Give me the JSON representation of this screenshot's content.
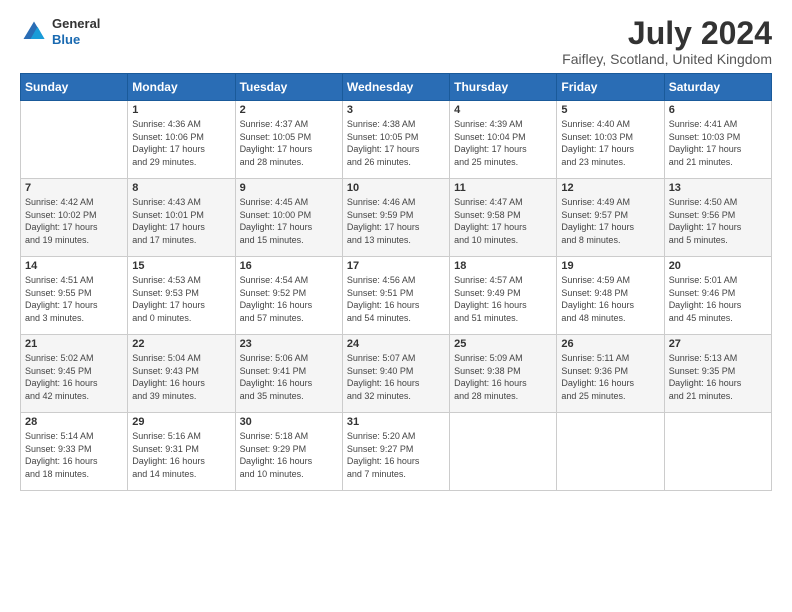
{
  "header": {
    "logo_general": "General",
    "logo_blue": "Blue",
    "month_title": "July 2024",
    "location": "Faifley, Scotland, United Kingdom"
  },
  "days_of_week": [
    "Sunday",
    "Monday",
    "Tuesday",
    "Wednesday",
    "Thursday",
    "Friday",
    "Saturday"
  ],
  "weeks": [
    [
      {
        "day": "",
        "info": ""
      },
      {
        "day": "1",
        "info": "Sunrise: 4:36 AM\nSunset: 10:06 PM\nDaylight: 17 hours\nand 29 minutes."
      },
      {
        "day": "2",
        "info": "Sunrise: 4:37 AM\nSunset: 10:05 PM\nDaylight: 17 hours\nand 28 minutes."
      },
      {
        "day": "3",
        "info": "Sunrise: 4:38 AM\nSunset: 10:05 PM\nDaylight: 17 hours\nand 26 minutes."
      },
      {
        "day": "4",
        "info": "Sunrise: 4:39 AM\nSunset: 10:04 PM\nDaylight: 17 hours\nand 25 minutes."
      },
      {
        "day": "5",
        "info": "Sunrise: 4:40 AM\nSunset: 10:03 PM\nDaylight: 17 hours\nand 23 minutes."
      },
      {
        "day": "6",
        "info": "Sunrise: 4:41 AM\nSunset: 10:03 PM\nDaylight: 17 hours\nand 21 minutes."
      }
    ],
    [
      {
        "day": "7",
        "info": "Sunrise: 4:42 AM\nSunset: 10:02 PM\nDaylight: 17 hours\nand 19 minutes."
      },
      {
        "day": "8",
        "info": "Sunrise: 4:43 AM\nSunset: 10:01 PM\nDaylight: 17 hours\nand 17 minutes."
      },
      {
        "day": "9",
        "info": "Sunrise: 4:45 AM\nSunset: 10:00 PM\nDaylight: 17 hours\nand 15 minutes."
      },
      {
        "day": "10",
        "info": "Sunrise: 4:46 AM\nSunset: 9:59 PM\nDaylight: 17 hours\nand 13 minutes."
      },
      {
        "day": "11",
        "info": "Sunrise: 4:47 AM\nSunset: 9:58 PM\nDaylight: 17 hours\nand 10 minutes."
      },
      {
        "day": "12",
        "info": "Sunrise: 4:49 AM\nSunset: 9:57 PM\nDaylight: 17 hours\nand 8 minutes."
      },
      {
        "day": "13",
        "info": "Sunrise: 4:50 AM\nSunset: 9:56 PM\nDaylight: 17 hours\nand 5 minutes."
      }
    ],
    [
      {
        "day": "14",
        "info": "Sunrise: 4:51 AM\nSunset: 9:55 PM\nDaylight: 17 hours\nand 3 minutes."
      },
      {
        "day": "15",
        "info": "Sunrise: 4:53 AM\nSunset: 9:53 PM\nDaylight: 17 hours\nand 0 minutes."
      },
      {
        "day": "16",
        "info": "Sunrise: 4:54 AM\nSunset: 9:52 PM\nDaylight: 16 hours\nand 57 minutes."
      },
      {
        "day": "17",
        "info": "Sunrise: 4:56 AM\nSunset: 9:51 PM\nDaylight: 16 hours\nand 54 minutes."
      },
      {
        "day": "18",
        "info": "Sunrise: 4:57 AM\nSunset: 9:49 PM\nDaylight: 16 hours\nand 51 minutes."
      },
      {
        "day": "19",
        "info": "Sunrise: 4:59 AM\nSunset: 9:48 PM\nDaylight: 16 hours\nand 48 minutes."
      },
      {
        "day": "20",
        "info": "Sunrise: 5:01 AM\nSunset: 9:46 PM\nDaylight: 16 hours\nand 45 minutes."
      }
    ],
    [
      {
        "day": "21",
        "info": "Sunrise: 5:02 AM\nSunset: 9:45 PM\nDaylight: 16 hours\nand 42 minutes."
      },
      {
        "day": "22",
        "info": "Sunrise: 5:04 AM\nSunset: 9:43 PM\nDaylight: 16 hours\nand 39 minutes."
      },
      {
        "day": "23",
        "info": "Sunrise: 5:06 AM\nSunset: 9:41 PM\nDaylight: 16 hours\nand 35 minutes."
      },
      {
        "day": "24",
        "info": "Sunrise: 5:07 AM\nSunset: 9:40 PM\nDaylight: 16 hours\nand 32 minutes."
      },
      {
        "day": "25",
        "info": "Sunrise: 5:09 AM\nSunset: 9:38 PM\nDaylight: 16 hours\nand 28 minutes."
      },
      {
        "day": "26",
        "info": "Sunrise: 5:11 AM\nSunset: 9:36 PM\nDaylight: 16 hours\nand 25 minutes."
      },
      {
        "day": "27",
        "info": "Sunrise: 5:13 AM\nSunset: 9:35 PM\nDaylight: 16 hours\nand 21 minutes."
      }
    ],
    [
      {
        "day": "28",
        "info": "Sunrise: 5:14 AM\nSunset: 9:33 PM\nDaylight: 16 hours\nand 18 minutes."
      },
      {
        "day": "29",
        "info": "Sunrise: 5:16 AM\nSunset: 9:31 PM\nDaylight: 16 hours\nand 14 minutes."
      },
      {
        "day": "30",
        "info": "Sunrise: 5:18 AM\nSunset: 9:29 PM\nDaylight: 16 hours\nand 10 minutes."
      },
      {
        "day": "31",
        "info": "Sunrise: 5:20 AM\nSunset: 9:27 PM\nDaylight: 16 hours\nand 7 minutes."
      },
      {
        "day": "",
        "info": ""
      },
      {
        "day": "",
        "info": ""
      },
      {
        "day": "",
        "info": ""
      }
    ]
  ]
}
